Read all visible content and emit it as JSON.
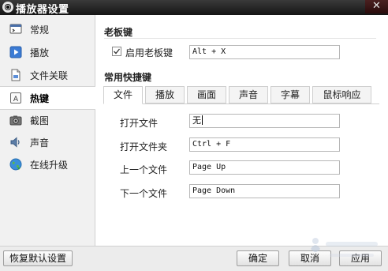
{
  "window": {
    "title": "播放器设置",
    "close_glyph": "✕"
  },
  "sidebar": {
    "items": [
      {
        "label": "常规",
        "icon": "general-icon",
        "active": false
      },
      {
        "label": "播放",
        "icon": "play-icon",
        "active": false
      },
      {
        "label": "文件关联",
        "icon": "file-icon",
        "active": false
      },
      {
        "label": "热键",
        "icon": "hotkey-icon",
        "active": true
      },
      {
        "label": "截图",
        "icon": "camera-icon",
        "active": false
      },
      {
        "label": "声音",
        "icon": "speaker-icon",
        "active": false
      },
      {
        "label": "在线升级",
        "icon": "globe-icon",
        "active": false
      }
    ]
  },
  "boss_key": {
    "section_title": "老板键",
    "enable_label": "启用老板键",
    "enabled": true,
    "value": "Alt + X"
  },
  "shortcuts": {
    "section_title": "常用快捷键",
    "tabs": [
      "文件",
      "播放",
      "画面",
      "声音",
      "字幕",
      "鼠标响应"
    ],
    "active_tab": "文件",
    "rows": [
      {
        "label": "打开文件",
        "value": "无"
      },
      {
        "label": "打开文件夹",
        "value": "Ctrl + F"
      },
      {
        "label": "上一个文件",
        "value": "Page Up"
      },
      {
        "label": "下一个文件",
        "value": "Page Down"
      }
    ]
  },
  "footer": {
    "restore_defaults": "恢复默认设置",
    "ok": "确定",
    "cancel": "取消",
    "apply": "应用"
  },
  "colors": {
    "titlebar": "#1e1e1e",
    "sidebar_bg": "#f1f1f1",
    "active_nav_bg": "#ffffff",
    "panel_bg": "#ffffff"
  }
}
